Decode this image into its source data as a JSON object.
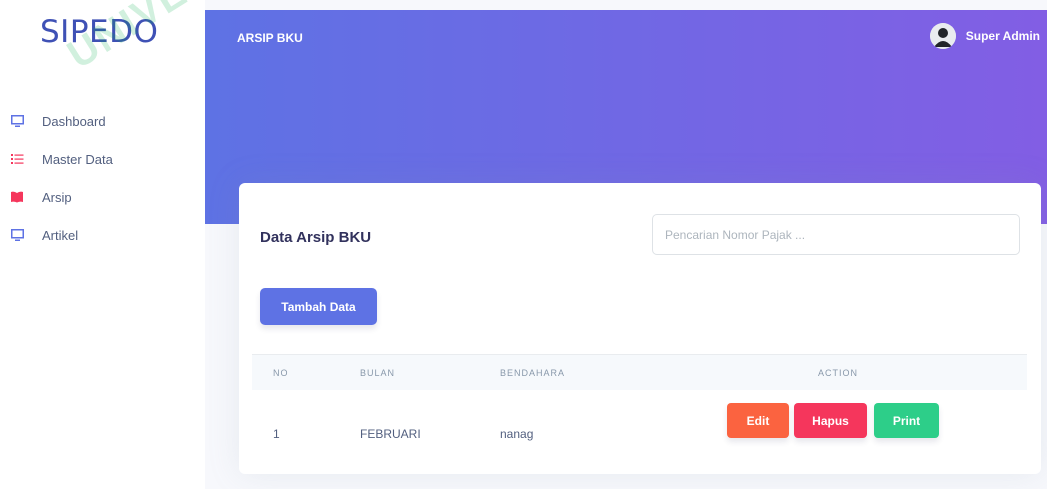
{
  "sidebar": {
    "brand": "SIPEDO",
    "watermark": "UNIVERS",
    "items": [
      {
        "label": "Dashboard",
        "icon": "monitor-icon",
        "color": "#5e72e4"
      },
      {
        "label": "Master Data",
        "icon": "list-icon",
        "color": "#f5365c"
      },
      {
        "label": "Arsip",
        "icon": "book-icon",
        "color": "#f5365c"
      },
      {
        "label": "Artikel",
        "icon": "monitor-icon",
        "color": "#5e72e4"
      }
    ]
  },
  "header": {
    "title": "ARSIP BKU",
    "user_name": "Super Admin",
    "gradient_start": "#5e72e4",
    "gradient_end": "#825ee4"
  },
  "card": {
    "title": "Data Arsip BKU",
    "search_placeholder": "Pencarian Nomor Pajak ...",
    "add_button": "Tambah Data"
  },
  "table": {
    "columns": [
      "NO",
      "BULAN",
      "BENDAHARA",
      "ACTION"
    ],
    "rows": [
      {
        "no": "1",
        "bulan": "FEBRUARI",
        "bendahara": "nanag",
        "actions": [
          "Edit",
          "Hapus",
          "Print"
        ]
      }
    ]
  }
}
